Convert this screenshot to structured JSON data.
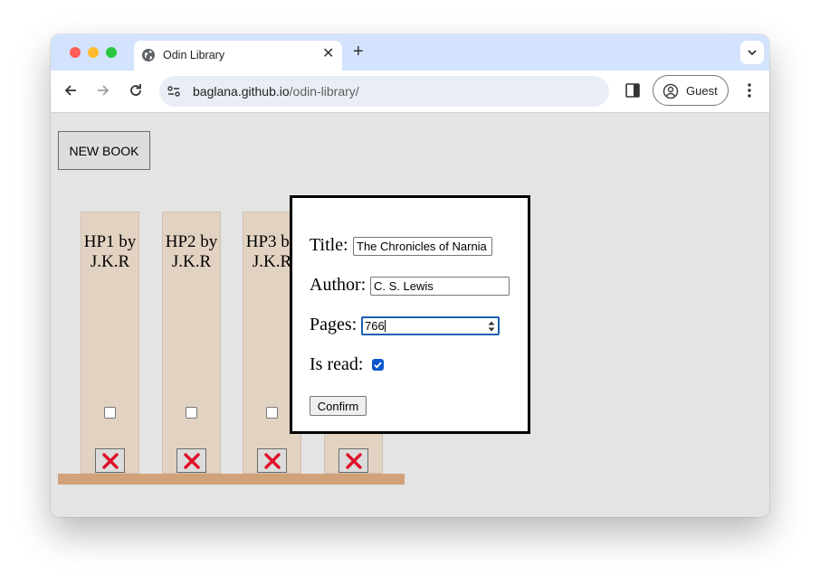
{
  "browser": {
    "tab_title": "Odin Library",
    "url_domain": "baglana.github.io",
    "url_path": "/odin-library/",
    "profile_label": "Guest"
  },
  "page": {
    "new_book_label": "NEW BOOK",
    "books": [
      {
        "title": "HP1 by\nJ.K.R",
        "read": false
      },
      {
        "title": "HP2 by\nJ.K.R",
        "read": false
      },
      {
        "title": "HP3 by\nJ.K.R",
        "read": false
      },
      {
        "title": "",
        "read": false
      }
    ]
  },
  "dialog": {
    "title_label": "Title:",
    "title_value": "The Chronicles of Narnia",
    "author_label": "Author:",
    "author_value": "C. S. Lewis",
    "pages_label": "Pages:",
    "pages_value": "766",
    "is_read_label": "Is read:",
    "is_read": true,
    "confirm_label": "Confirm"
  },
  "colors": {
    "page_bg": "#e4e4e4",
    "book_bg": "#e2d2c2",
    "shelf": "#d1a27a",
    "delete_icon": "#e0102a",
    "checkbox_accent": "#0b57d0"
  }
}
